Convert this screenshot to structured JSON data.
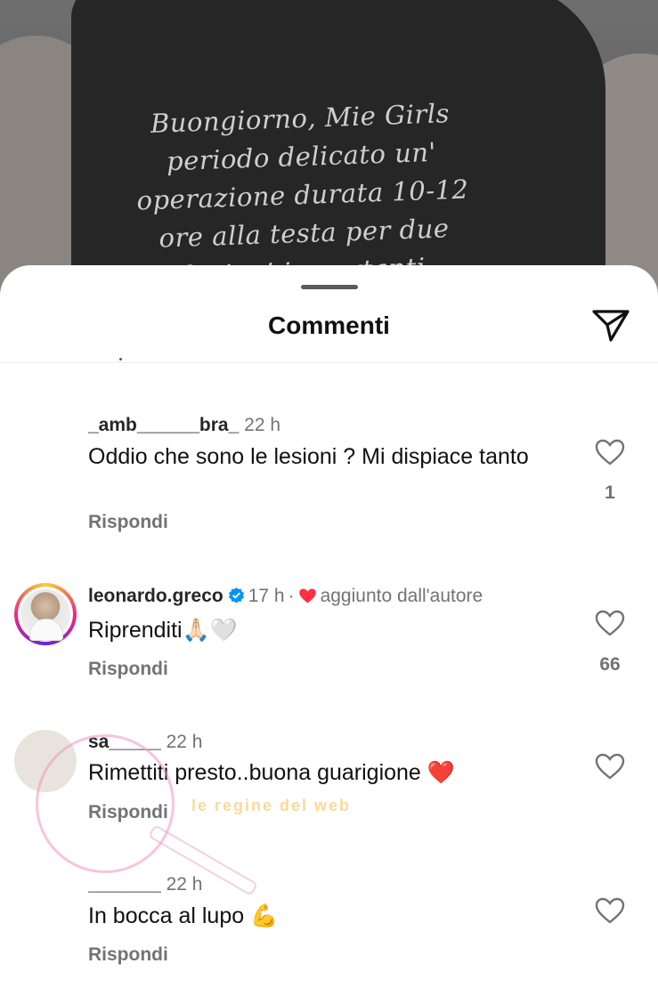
{
  "story": {
    "caption_lines": [
      "Buongiorno, Mie Girls",
      "periodo delicato un'",
      "operazione durata 10-12",
      "ore alla testa per due",
      "lesioni importanti"
    ]
  },
  "sheet": {
    "title": "Commenti",
    "send_icon": "paper-plane-icon"
  },
  "comments": [
    {
      "username": "_amb______bra_",
      "time": "22 h",
      "text": "Oddio che sono le lesioni ? Mi dispiace tanto",
      "reply_label": "Rispondi",
      "likes": "1"
    },
    {
      "username": "leonardo.greco",
      "verified": true,
      "time": "17 h",
      "liked_by_author": "aggiunto dall'autore",
      "text": "Riprenditi🙏🏻🤍",
      "reply_label": "Rispondi",
      "likes": "66"
    },
    {
      "username": "sa_____",
      "time": "22 h",
      "text": "Rimettiti presto..buona guarigione ❤️",
      "reply_label": "Rispondi",
      "likes": ""
    },
    {
      "username": "_______",
      "time": "22 h",
      "text": "In bocca al lupo 💪",
      "reply_label": "Rispondi",
      "likes": ""
    }
  ],
  "watermark": {
    "text": "le regine del web"
  },
  "colors": {
    "heart_red": "#ff3040",
    "verified_blue": "#0095f6",
    "muted": "#737373"
  }
}
